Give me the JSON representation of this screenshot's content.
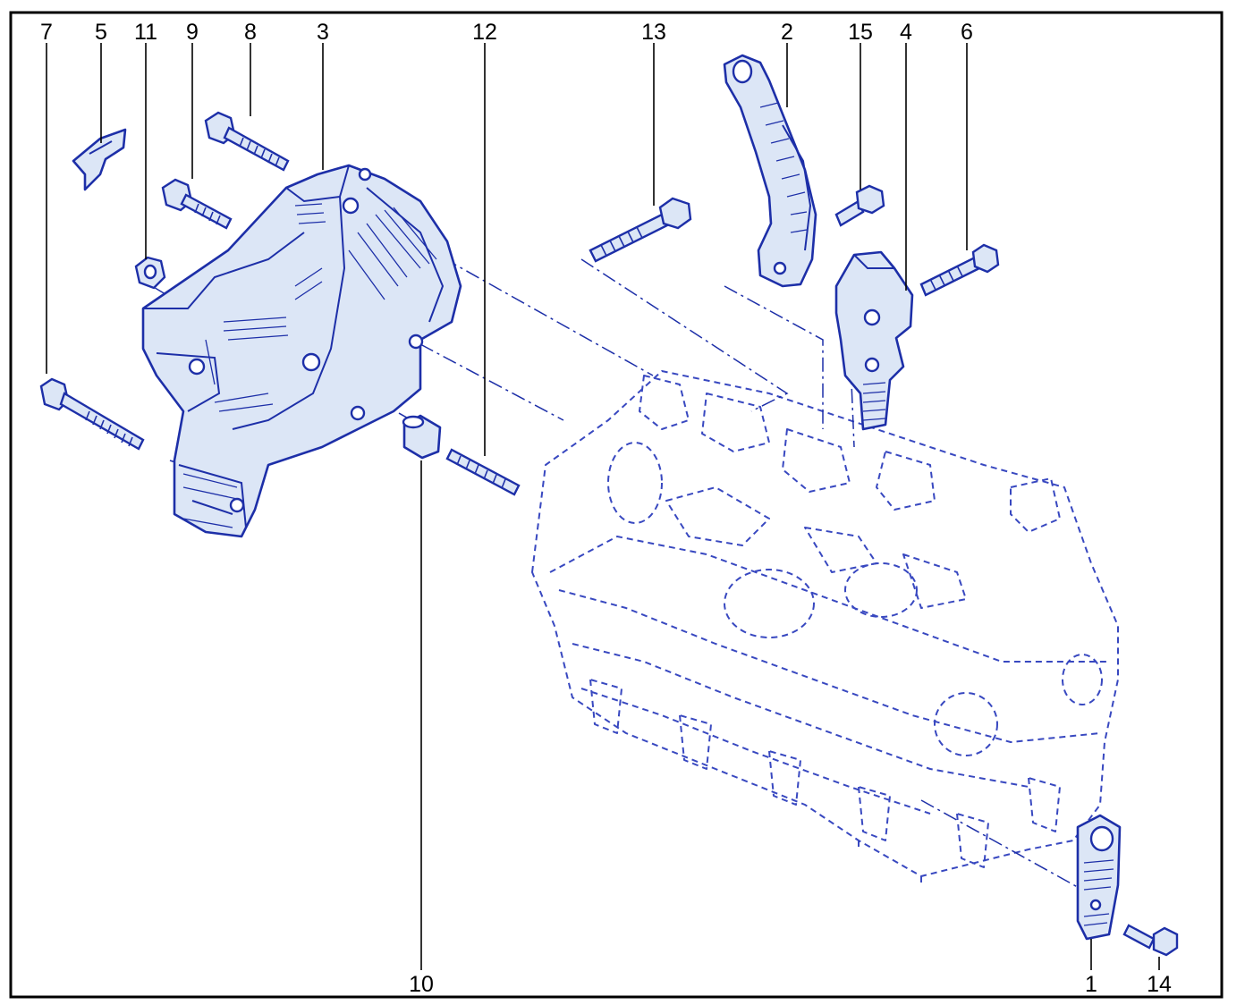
{
  "diagram": {
    "callouts": [
      {
        "id": "7",
        "label": "7"
      },
      {
        "id": "5",
        "label": "5"
      },
      {
        "id": "11",
        "label": "11"
      },
      {
        "id": "9",
        "label": "9"
      },
      {
        "id": "8",
        "label": "8"
      },
      {
        "id": "3",
        "label": "3"
      },
      {
        "id": "12",
        "label": "12"
      },
      {
        "id": "13",
        "label": "13"
      },
      {
        "id": "2",
        "label": "2"
      },
      {
        "id": "15",
        "label": "15"
      },
      {
        "id": "4",
        "label": "4"
      },
      {
        "id": "6",
        "label": "6"
      },
      {
        "id": "10",
        "label": "10"
      },
      {
        "id": "1",
        "label": "1"
      },
      {
        "id": "14",
        "label": "14"
      }
    ],
    "colors": {
      "line_art": "#1d2fa8",
      "part_fill": "#dce6f6",
      "frame": "#000000",
      "background": "#ffffff"
    }
  }
}
